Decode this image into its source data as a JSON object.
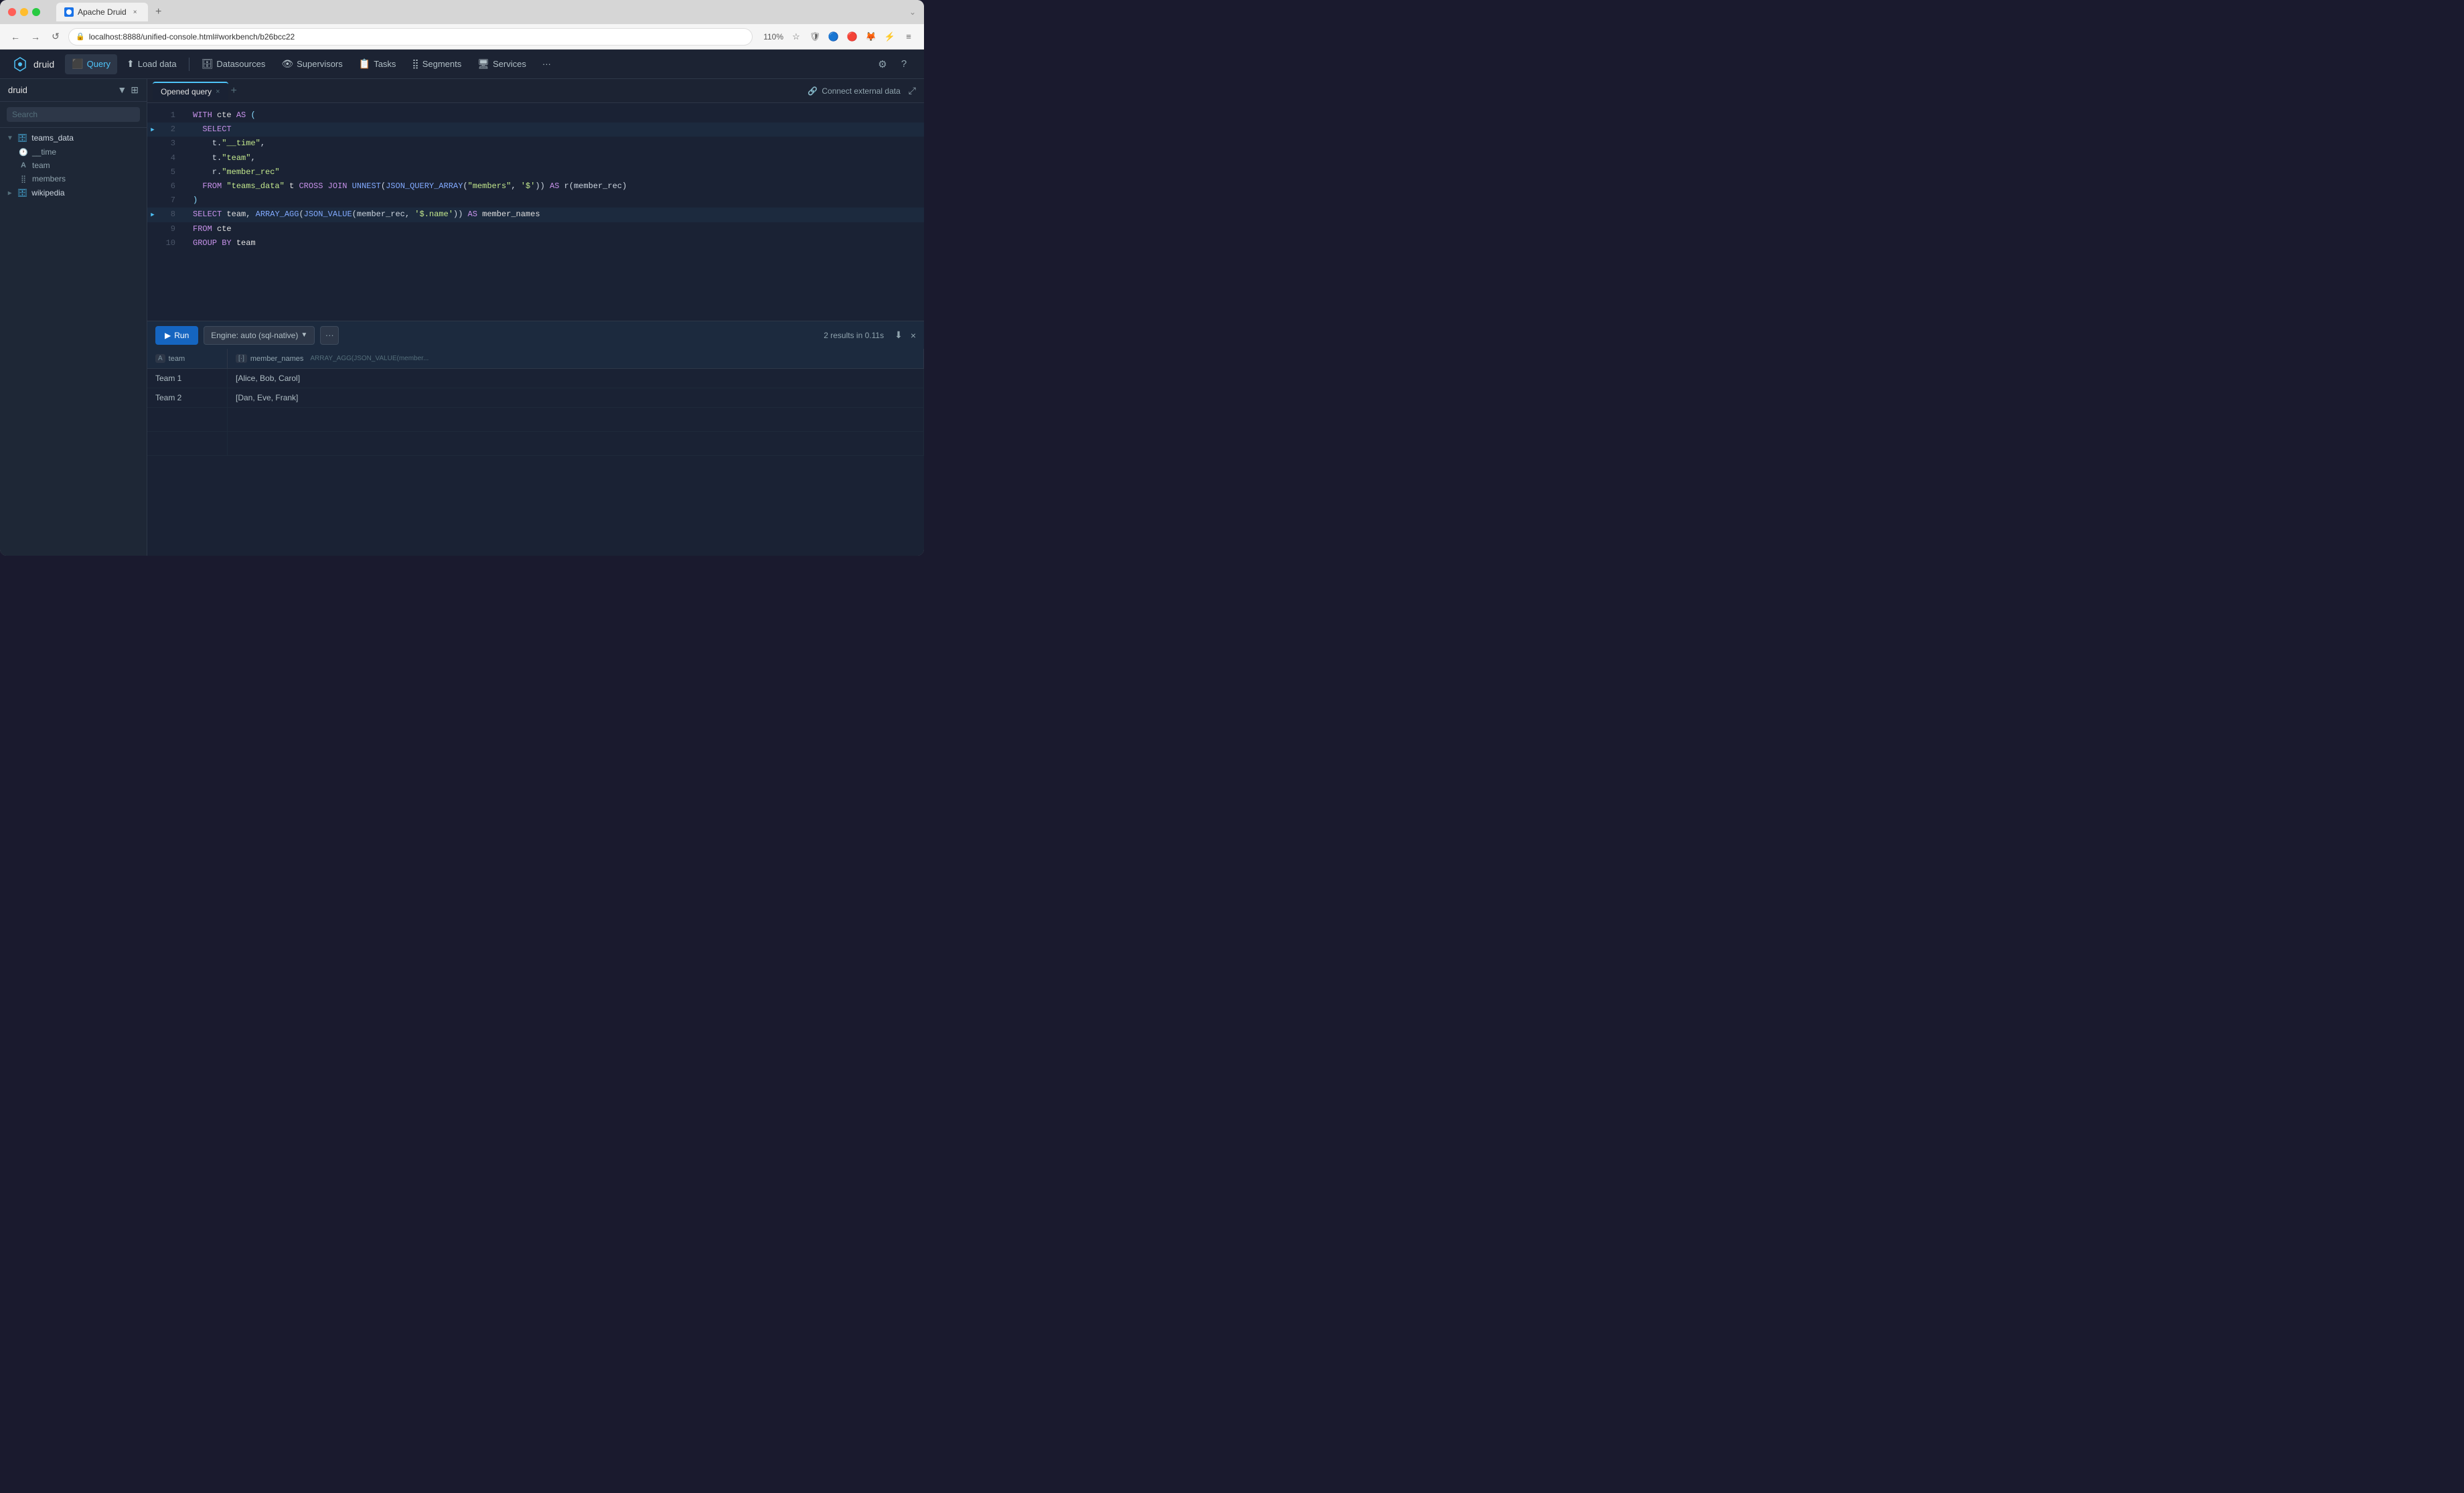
{
  "browser": {
    "tab_favicon": "🔵",
    "tab_title": "Apache Druid",
    "tab_close": "×",
    "tab_new": "+",
    "back_btn": "←",
    "forward_btn": "→",
    "refresh_btn": "↺",
    "address_url": "localhost:8888/unified-console.html#workbench/b26bcc22",
    "zoom_level": "110%",
    "nav_down": "⌄"
  },
  "app": {
    "logo_text": "druid",
    "nav_items": [
      {
        "id": "query",
        "label": "Query",
        "icon": "⬛"
      },
      {
        "id": "load-data",
        "label": "Load data",
        "icon": "⬆"
      },
      {
        "id": "datasources",
        "label": "Datasources",
        "icon": "🗄"
      },
      {
        "id": "supervisors",
        "label": "Supervisors",
        "icon": "👁"
      },
      {
        "id": "tasks",
        "label": "Tasks",
        "icon": "📋"
      },
      {
        "id": "segments",
        "label": "Segments",
        "icon": "⣿"
      },
      {
        "id": "services",
        "label": "Services",
        "icon": "🖥"
      },
      {
        "id": "more",
        "label": "···",
        "icon": ""
      }
    ],
    "settings_icon": "⚙",
    "help_icon": "?"
  },
  "sidebar": {
    "title": "druid",
    "search_placeholder": "Search",
    "expand_icon": "▼",
    "columns_icon": "⊞",
    "datasources": [
      {
        "name": "teams_data",
        "expanded": true,
        "columns": [
          {
            "name": "__time",
            "type": "clock",
            "type_char": "🕐"
          },
          {
            "name": "team",
            "type": "string",
            "type_char": "A"
          },
          {
            "name": "members",
            "type": "array",
            "type_char": "⣿"
          }
        ]
      },
      {
        "name": "wikipedia",
        "expanded": false,
        "columns": []
      }
    ]
  },
  "query_editor": {
    "tab_label": "Opened query",
    "tab_close": "×",
    "tab_new": "+",
    "connect_external": "Connect external data",
    "expand_icon": "⤢",
    "code_lines": [
      {
        "num": 1,
        "has_run": false,
        "content": "WITH cte AS ("
      },
      {
        "num": 2,
        "has_run": true,
        "content": "  SELECT"
      },
      {
        "num": 3,
        "has_run": false,
        "content": "    t.\"__time\","
      },
      {
        "num": 4,
        "has_run": false,
        "content": "    t.\"team\","
      },
      {
        "num": 5,
        "has_run": false,
        "content": "    r.\"member_rec\""
      },
      {
        "num": 6,
        "has_run": false,
        "content": "  FROM \"teams_data\" t CROSS JOIN UNNEST(JSON_QUERY_ARRAY(\"members\", '$')) AS r(member_rec)"
      },
      {
        "num": 7,
        "has_run": false,
        "content": ")"
      },
      {
        "num": 8,
        "has_run": true,
        "content": "SELECT team, ARRAY_AGG(JSON_VALUE(member_rec, '$.name')) AS member_names"
      },
      {
        "num": 9,
        "has_run": false,
        "content": "FROM cte"
      },
      {
        "num": 10,
        "has_run": false,
        "content": "GROUP BY team"
      }
    ]
  },
  "run_bar": {
    "run_label": "Run",
    "engine_label": "Engine: auto (sql-native)",
    "engine_chevron": "▼",
    "more_icon": "···",
    "results_info": "2 results in 0.11s",
    "download_icon": "⬇",
    "close_icon": "×"
  },
  "results": {
    "columns": [
      {
        "id": "team",
        "type_badge": "A",
        "label": "team",
        "subtext": ""
      },
      {
        "id": "member_names",
        "type_badge": "[·]",
        "label": "member_names",
        "subtext": "ARRAY_AGG(JSON_VALUE(member..."
      }
    ],
    "rows": [
      {
        "team": "Team 1",
        "member_names": "[Alice, Bob, Carol]"
      },
      {
        "team": "Team 2",
        "member_names": "[Dan, Eve, Frank]"
      }
    ]
  }
}
